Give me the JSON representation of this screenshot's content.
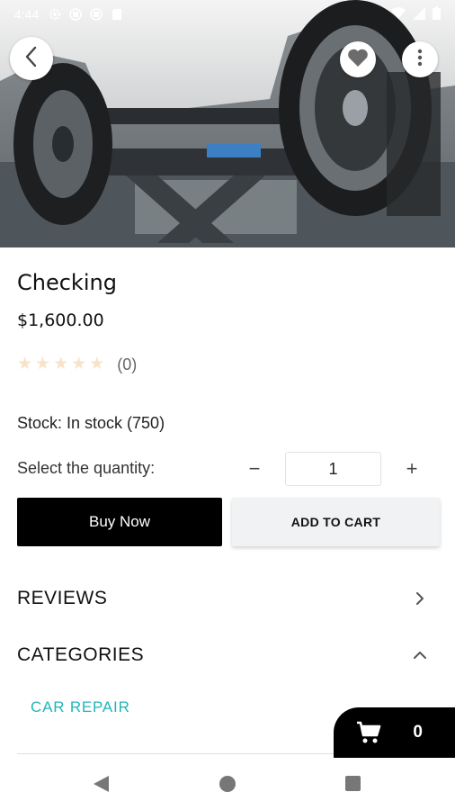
{
  "status_bar": {
    "time": "4:44"
  },
  "header": {
    "back_icon": "chevron-left-icon",
    "favorite_icon": "heart-icon",
    "more_icon": "more-vertical-icon"
  },
  "product": {
    "title": "Checking",
    "price": "$1,600.00",
    "rating_value": 0,
    "rating_max": 5,
    "rating_count": "(0)",
    "stock": "Stock: In stock (750)"
  },
  "quantity": {
    "label": "Select the quantity:",
    "minus": "−",
    "value": "1",
    "plus": "+"
  },
  "actions": {
    "buy_now": "Buy Now",
    "add_to_cart": "ADD TO CART"
  },
  "sections": {
    "reviews": "REVIEWS",
    "categories": "CATEGORIES"
  },
  "categories": [
    "CAR REPAIR"
  ],
  "cart": {
    "count": "0"
  },
  "colors": {
    "accent": "#23b5b9",
    "primary_button": "#000000",
    "secondary_button": "#f1f2f3",
    "star_empty": "#f8e3c8"
  }
}
